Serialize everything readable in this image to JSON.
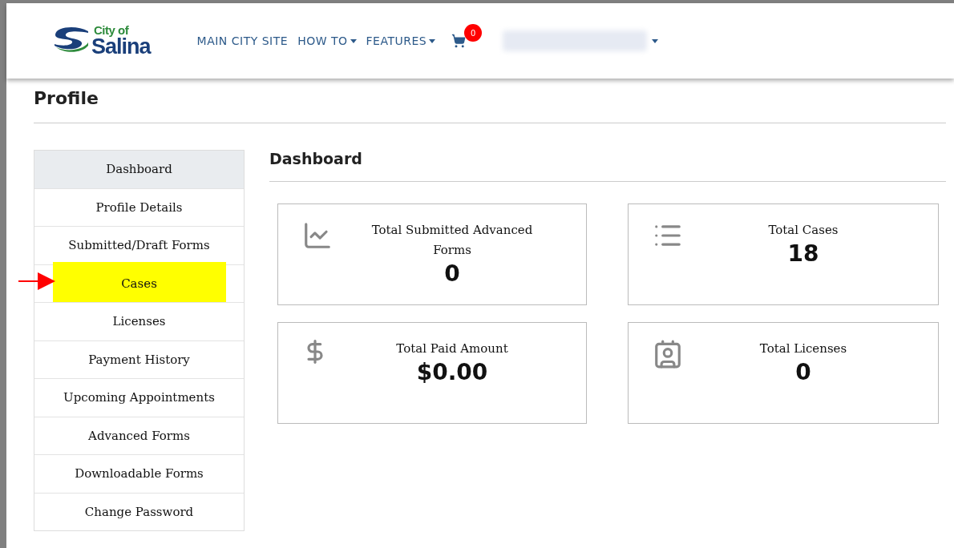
{
  "header": {
    "logo": {
      "line1": "City of",
      "line2": "Salina"
    },
    "nav": [
      {
        "label": "MAIN CITY SITE",
        "dropdown": false
      },
      {
        "label": "HOW TO",
        "dropdown": true
      },
      {
        "label": "FEATURES",
        "dropdown": true
      }
    ],
    "cart_count": "0"
  },
  "page_title": "Profile",
  "sidebar": [
    {
      "label": "Dashboard",
      "selected": true,
      "highlighted": false
    },
    {
      "label": "Profile Details",
      "selected": false,
      "highlighted": false
    },
    {
      "label": "Submitted/Draft Forms",
      "selected": false,
      "highlighted": false
    },
    {
      "label": "Cases",
      "selected": false,
      "highlighted": true
    },
    {
      "label": "Licenses",
      "selected": false,
      "highlighted": false
    },
    {
      "label": "Payment History",
      "selected": false,
      "highlighted": false
    },
    {
      "label": "Upcoming Appointments",
      "selected": false,
      "highlighted": false
    },
    {
      "label": "Advanced Forms",
      "selected": false,
      "highlighted": false
    },
    {
      "label": "Downloadable Forms",
      "selected": false,
      "highlighted": false
    },
    {
      "label": "Change Password",
      "selected": false,
      "highlighted": false
    }
  ],
  "section_title": "Dashboard",
  "cards": [
    {
      "kind": "chart",
      "title": "Total Submitted Advanced Forms",
      "value": "0"
    },
    {
      "kind": "list",
      "title": "Total Cases",
      "value": "18"
    },
    {
      "kind": "dollar",
      "title": "Total Paid Amount",
      "value": "$0.00"
    },
    {
      "kind": "badge",
      "title": "Total Licenses",
      "value": "0"
    }
  ]
}
